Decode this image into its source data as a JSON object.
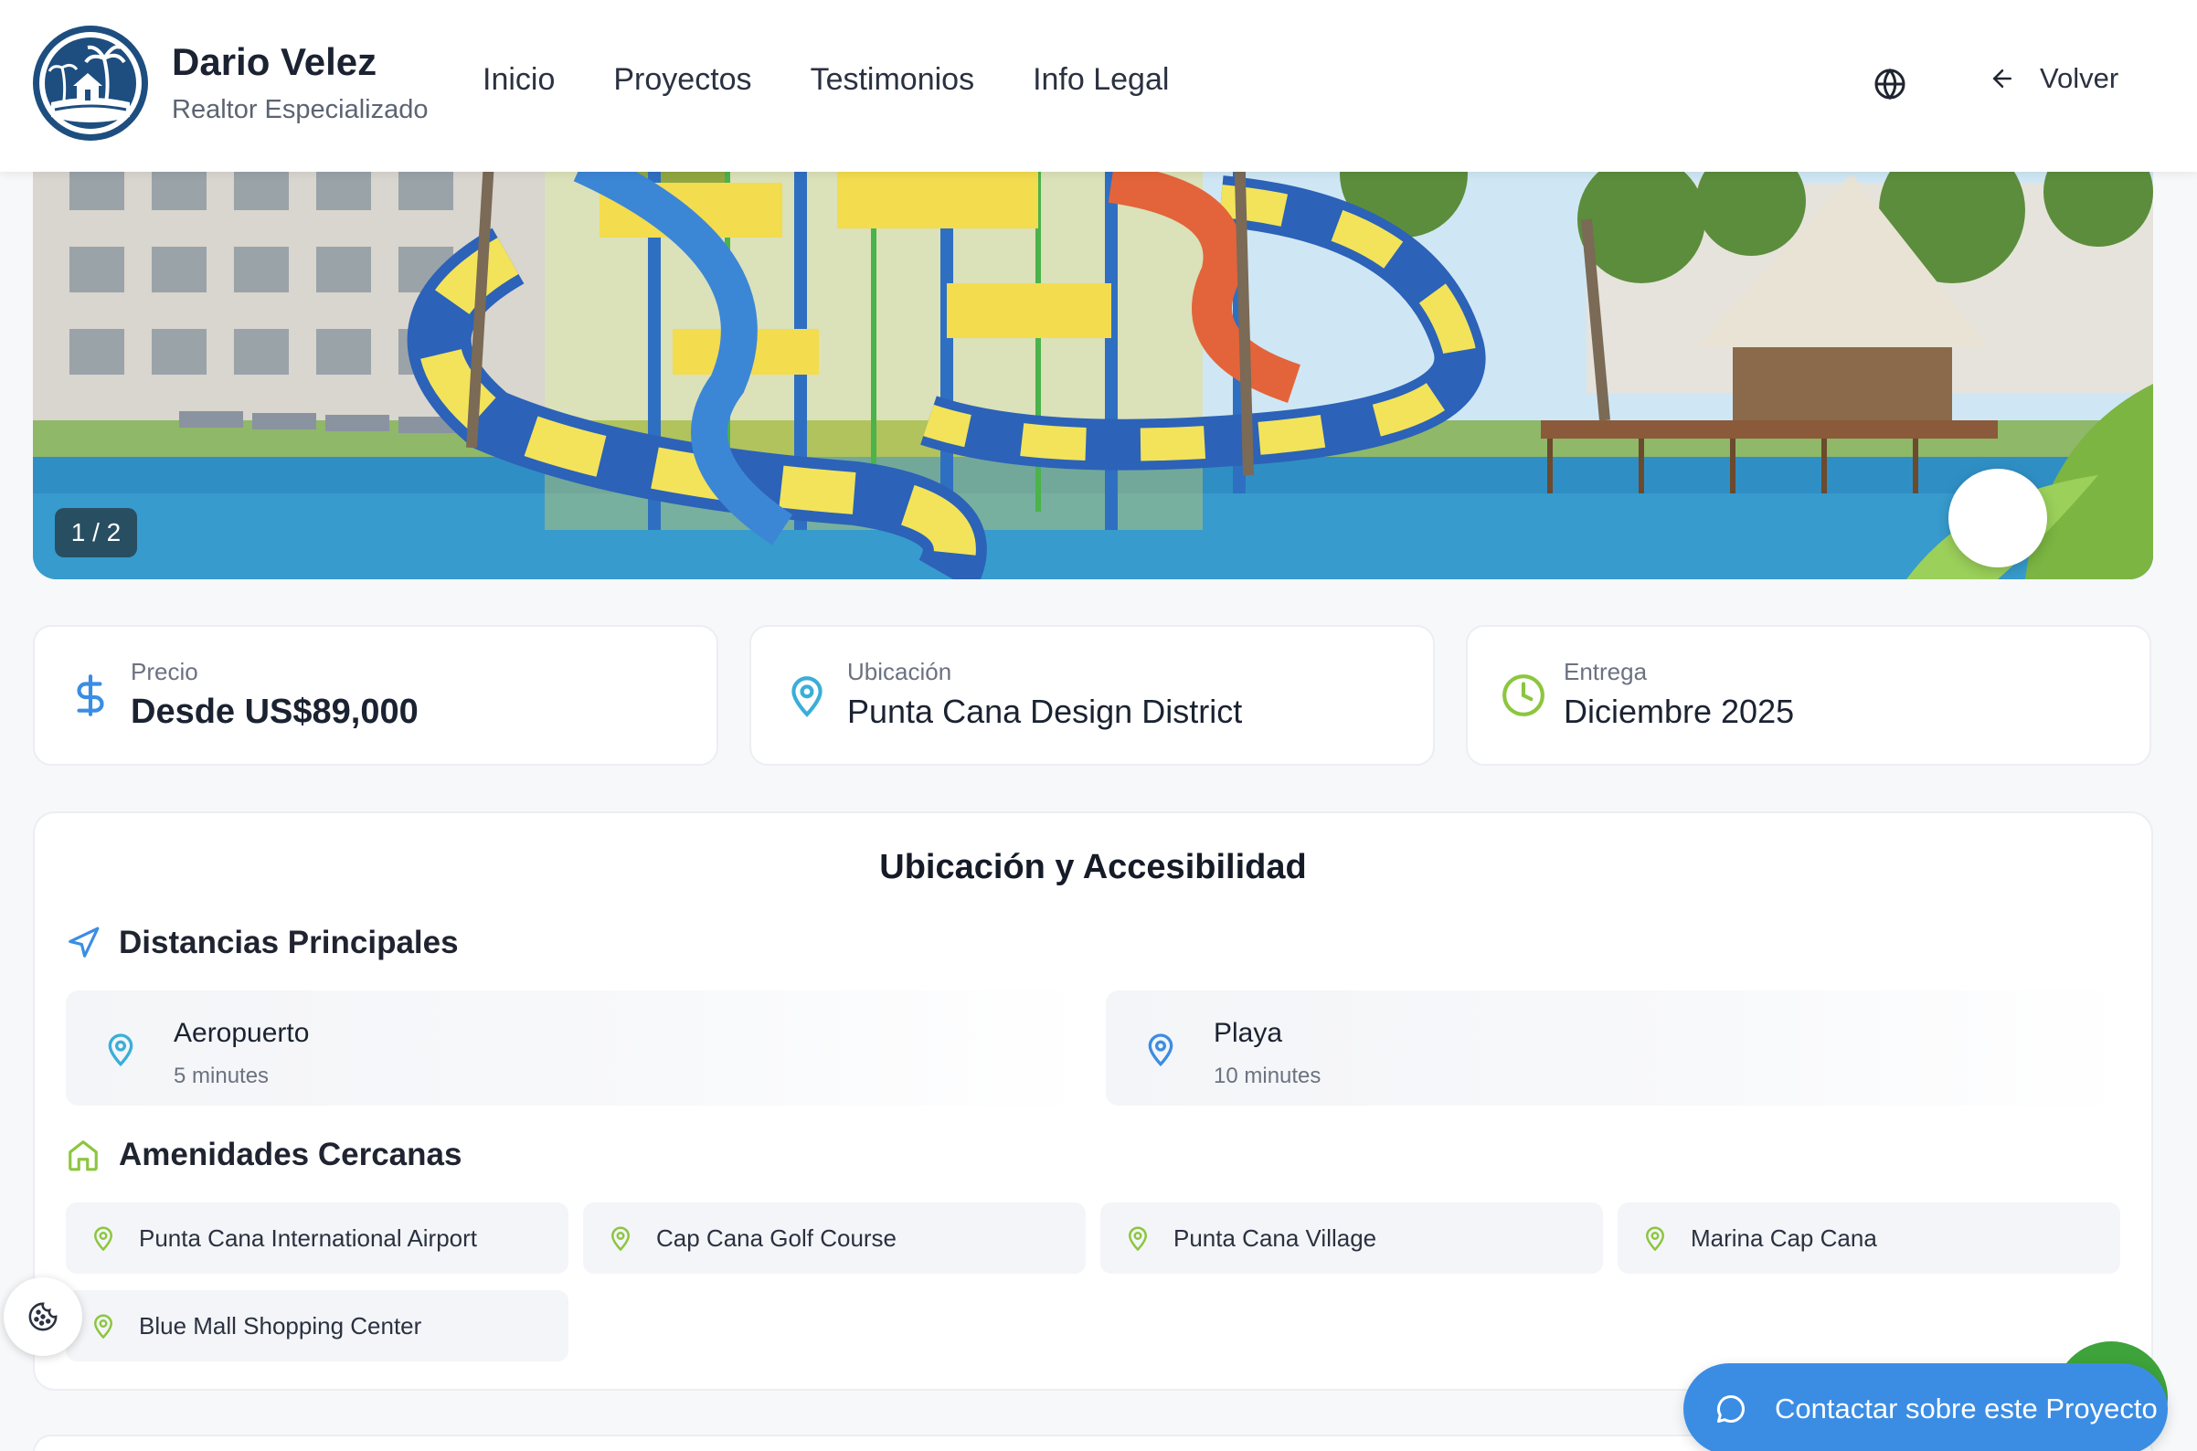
{
  "header": {
    "brand_name": "Dario Velez",
    "brand_subtitle": "Realtor Especializado",
    "nav": [
      "Inicio",
      "Proyectos",
      "Testimonios",
      "Info Legal"
    ],
    "language_icon": "globe-icon",
    "back_label": "Volver"
  },
  "gallery": {
    "counter": "1 / 2"
  },
  "info_cards": [
    {
      "label": "Precio",
      "value": "Desde US$89,000",
      "icon": "dollar-icon",
      "color": "#3b8de4"
    },
    {
      "label": "Ubicación",
      "value": "Punta Cana Design District",
      "icon": "map-pin-icon",
      "color": "#3aaed8"
    },
    {
      "label": "Entrega",
      "value": "Diciembre 2025",
      "icon": "clock-icon",
      "color": "#8cc63f"
    }
  ],
  "location": {
    "title": "Ubicación y Accesibilidad",
    "distances_heading": "Distancias Principales",
    "distances": [
      {
        "name": "Aeropuerto",
        "time": "5 minutes"
      },
      {
        "name": "Playa",
        "time": "10 minutes"
      }
    ],
    "amenities_heading": "Amenidades Cercanas",
    "amenities": [
      "Punta Cana International Airport",
      "Cap Cana Golf Course",
      "Punta Cana Village",
      "Marina Cap Cana",
      "Blue Mall Shopping Center"
    ]
  },
  "cta": {
    "label": "Contactar sobre este Proyecto"
  },
  "colors": {
    "accent_blue": "#3b8de4",
    "accent_green": "#8cc63f",
    "accent_teal": "#3aaed8",
    "brand_navy": "#1d4e7f"
  }
}
